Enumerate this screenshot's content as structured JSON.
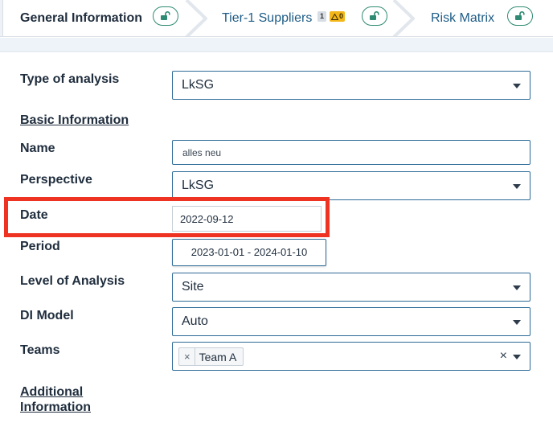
{
  "tabs": [
    {
      "label": "General Information",
      "active": true
    },
    {
      "label": "Tier-1 Suppliers",
      "active": false,
      "count_badge": "1",
      "warning_badge": "0"
    },
    {
      "label": "Risk Matrix",
      "active": false
    }
  ],
  "form": {
    "type_of_analysis": {
      "label": "Type of analysis",
      "value": "LkSG"
    },
    "basic_information": {
      "label": "Basic Information"
    },
    "name": {
      "label": "Name",
      "value": "alles neu"
    },
    "perspective": {
      "label": "Perspective",
      "value": "LkSG"
    },
    "date": {
      "label": "Date",
      "value": "2022-09-12"
    },
    "period": {
      "label": "Period",
      "value": "2023-01-01 - 2024-01-10"
    },
    "level_of_analysis": {
      "label": "Level of Analysis",
      "value": "Site"
    },
    "di_model": {
      "label": "DI Model",
      "value": "Auto"
    },
    "teams": {
      "label": "Teams",
      "tags": [
        "Team A"
      ],
      "remove_symbol": "×",
      "clear_symbol": "×"
    },
    "additional_information": {
      "label_line1": "Additional",
      "label_line2": "Information"
    }
  },
  "colors": {
    "highlight": "#ef3323",
    "accent": "#2e6b96",
    "lock": "#2f8a73",
    "warning": "#f3b71a"
  }
}
